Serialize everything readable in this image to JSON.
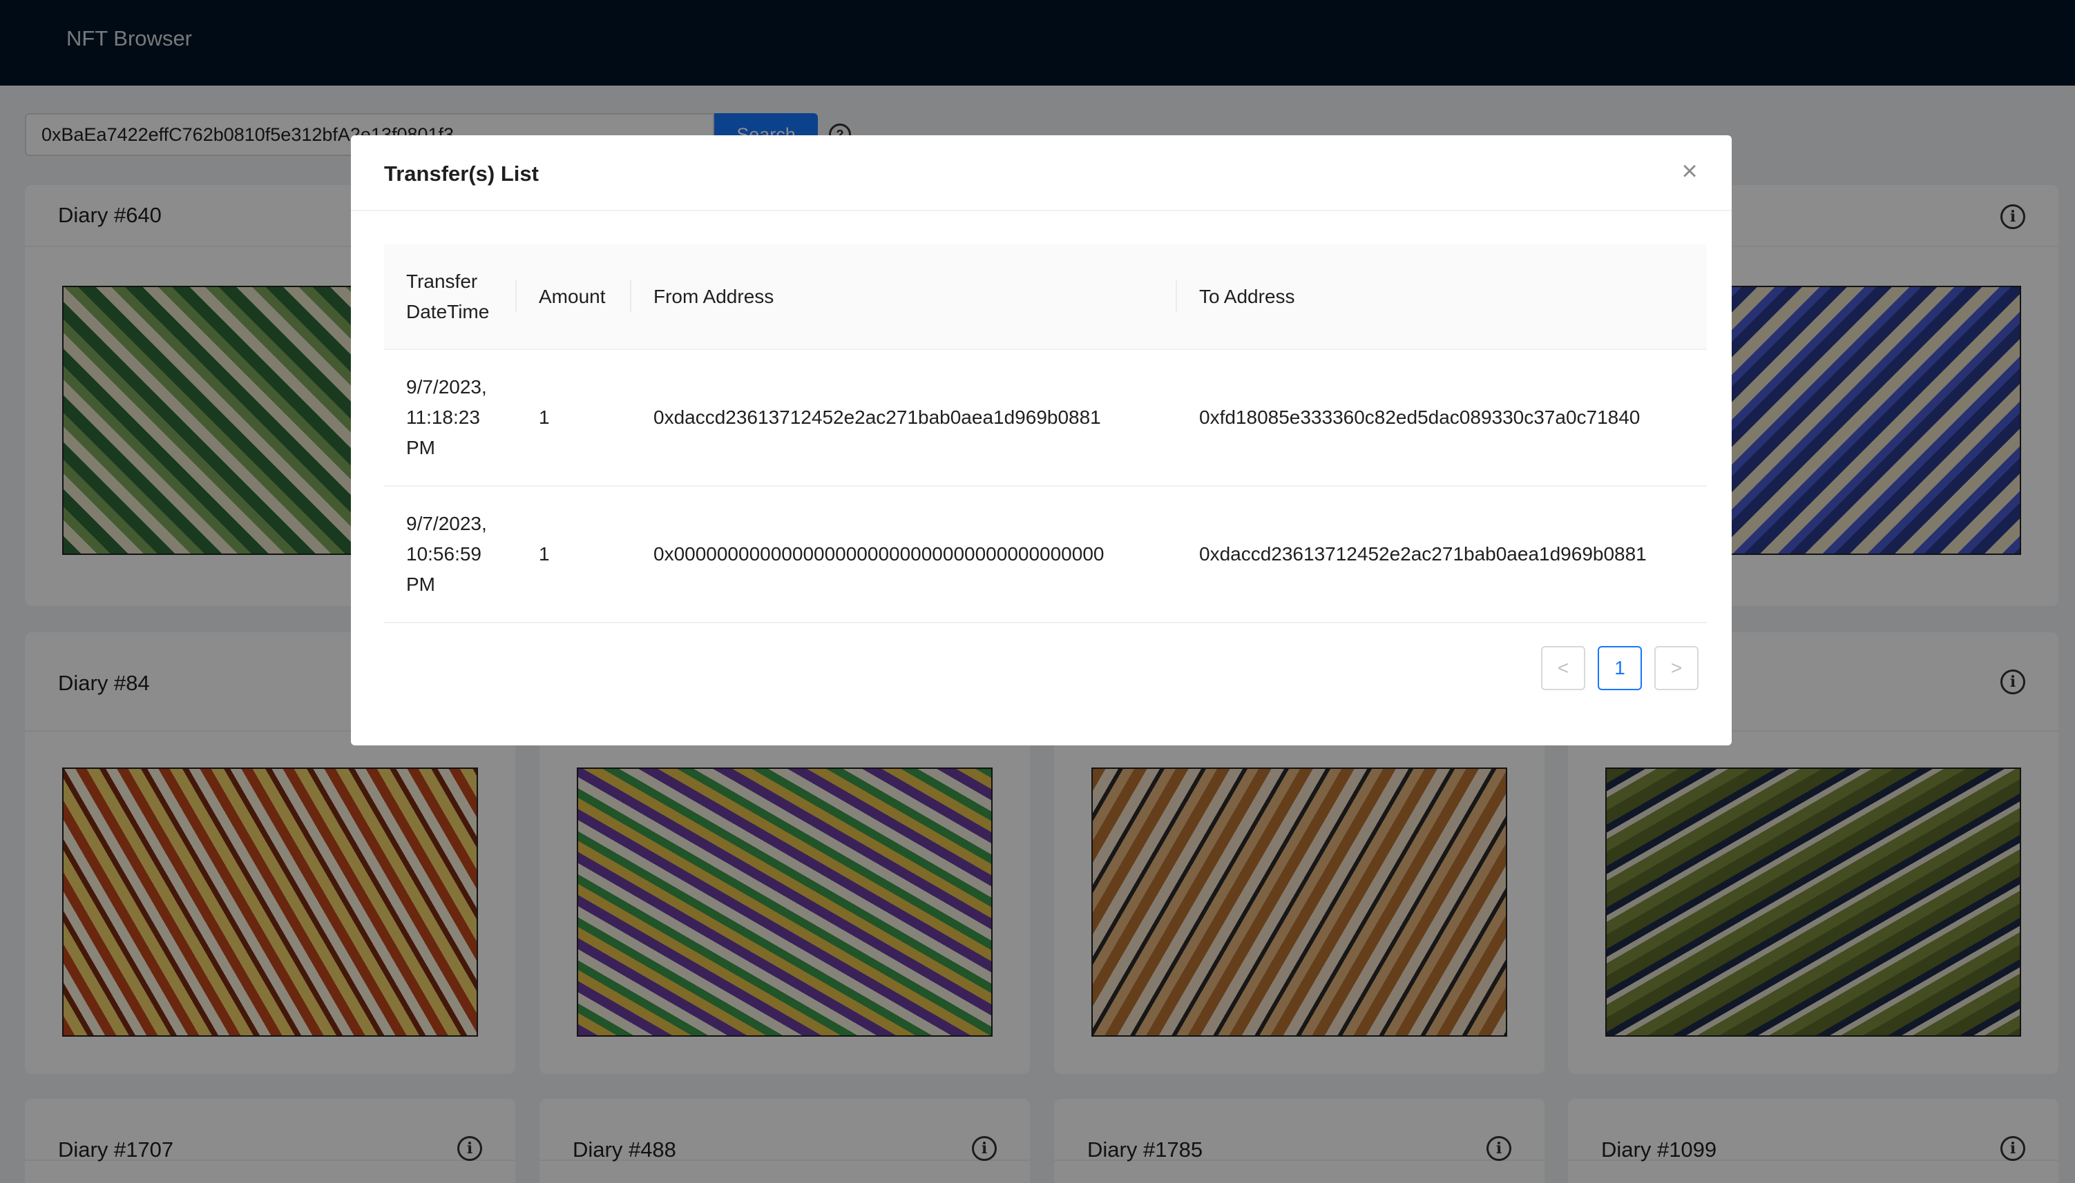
{
  "app": {
    "brand": "NFT Browser"
  },
  "search": {
    "value": "0xBaEa7422effC762b0810f5e312bfA2e13f0801f3",
    "button_label": "Search",
    "help_icon": "question-circle-icon"
  },
  "cards": [
    {
      "title": "Diary #640",
      "art_colors": [
        "#2f6b3a",
        "#e9e3c9",
        "#7da65a"
      ]
    },
    {
      "title": "",
      "art_colors": [
        "#2a3a8c",
        "#e7dfc2",
        "#4a5bd0"
      ]
    },
    {
      "title": "Diary #84",
      "art_colors": [
        "#c2471c",
        "#f2d36b",
        "#7a2c15"
      ]
    },
    {
      "title": "",
      "art_colors": [
        "#6b3fa0",
        "#e8c14a",
        "#3d9a4a"
      ]
    },
    {
      "title": "",
      "art_colors": [
        "#b87332",
        "#f0e1c8",
        "#2b2b2b"
      ]
    },
    {
      "title": "",
      "art_colors": [
        "#5c6b2a",
        "#1e2a4a",
        "#e6e0cf"
      ]
    },
    {
      "title": "Diary #1707"
    },
    {
      "title": "Diary #488"
    },
    {
      "title": "Diary #1785"
    },
    {
      "title": "Diary #1099"
    }
  ],
  "modal": {
    "title": "Transfer(s) List",
    "close_icon": "close-icon",
    "columns": {
      "datetime": "Transfer DateTime",
      "amount": "Amount",
      "from": "From Address",
      "to": "To Address"
    },
    "rows": [
      {
        "datetime": "9/7/2023, 11:18:23 PM",
        "amount": "1",
        "from": "0xdaccd23613712452e2ac271bab0aea1d969b0881",
        "to": "0xfd18085e333360c82ed5dac089330c37a0c71840"
      },
      {
        "datetime": "9/7/2023, 10:56:59 PM",
        "amount": "1",
        "from": "0x0000000000000000000000000000000000000000",
        "to": "0xdaccd23613712452e2ac271bab0aea1d969b0881"
      }
    ],
    "pagination": {
      "prev": "<",
      "current": "1",
      "next": ">"
    }
  }
}
